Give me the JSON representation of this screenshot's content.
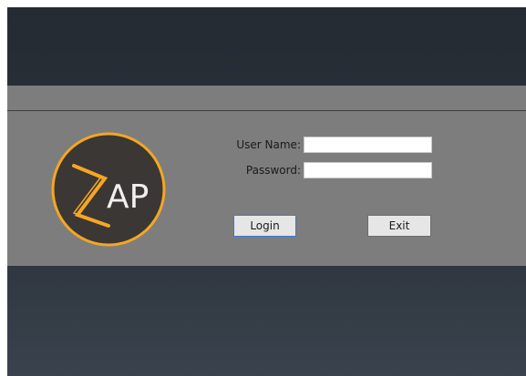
{
  "login_form": {
    "username_label": "User Name:",
    "username_value": "",
    "password_label": "Password:",
    "password_value": "",
    "login_button": "Login",
    "exit_button": "Exit"
  },
  "logo": {
    "text": "AP",
    "accent_color": "#f5a623",
    "background_color": "#3b3734"
  },
  "colors": {
    "window_bg": "#252b33",
    "panel_bg": "#7d7d7d"
  }
}
